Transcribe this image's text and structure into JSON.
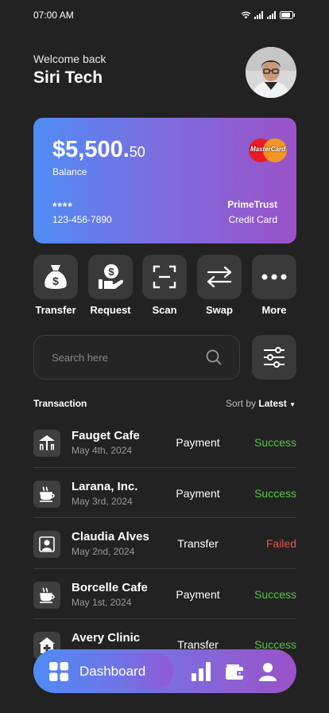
{
  "status_bar": {
    "time": "07:00 AM"
  },
  "header": {
    "greeting": "Welcome back",
    "user_name": "Siri Tech"
  },
  "card": {
    "balance_main": "$5,500.",
    "balance_cents": "50",
    "balance_label": "Balance",
    "masked": "****",
    "number": "123-456-7890",
    "bank": "PrimeTrust",
    "type": "Credit Card",
    "brand": "MasterCard"
  },
  "actions": [
    {
      "label": "Transfer",
      "icon": "money-bag-icon"
    },
    {
      "label": "Request",
      "icon": "hand-dollar-icon"
    },
    {
      "label": "Scan",
      "icon": "scan-frame-icon"
    },
    {
      "label": "Swap",
      "icon": "swap-arrows-icon"
    },
    {
      "label": "More",
      "icon": "more-dots-icon"
    }
  ],
  "search": {
    "placeholder": "Search here"
  },
  "transactions": {
    "heading": "Transaction",
    "sort_label": "Sort by",
    "sort_value": "Latest",
    "items": [
      {
        "name": "Fauget Cafe",
        "date": "May 4th, 2024",
        "type": "Payment",
        "status": "Success"
      },
      {
        "name": "Larana, Inc.",
        "date": "May 3rd, 2024",
        "type": "Payment",
        "status": "Success"
      },
      {
        "name": "Claudia Alves",
        "date": "May 2nd, 2024",
        "type": "Transfer",
        "status": "Failed"
      },
      {
        "name": "Borcelle Cafe",
        "date": "May 1st, 2024",
        "type": "Payment",
        "status": "Success"
      },
      {
        "name": "Avery Clinic",
        "date": "",
        "type": "Transfer",
        "status": "Success"
      }
    ]
  },
  "bottom_nav": {
    "active_label": "Dashboard"
  },
  "colors": {
    "success": "#59c445",
    "failed": "#e5534b",
    "accent_start": "#4f8cf6",
    "accent_end": "#9b52c8"
  }
}
